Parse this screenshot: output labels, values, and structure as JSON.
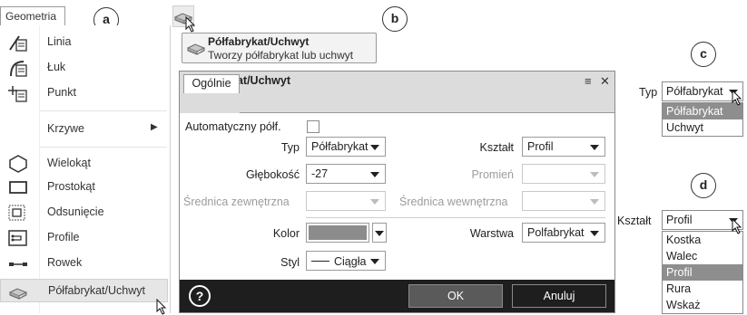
{
  "menu": {
    "tab_label": "Geometria",
    "callout": "a",
    "items": [
      {
        "label": "Linia",
        "icon": "line-icon"
      },
      {
        "label": "Łuk",
        "icon": "arc-icon"
      },
      {
        "label": "Punkt",
        "icon": "point-icon"
      },
      {
        "label": "Krzywe",
        "icon": "",
        "submenu_arrow": "▶"
      },
      {
        "label": "Wielokąt",
        "icon": "polygon-icon"
      },
      {
        "label": "Prostokąt",
        "icon": "rectangle-icon"
      },
      {
        "label": "Odsunięcie",
        "icon": "offset-icon"
      },
      {
        "label": "Profile",
        "icon": "profile-icon"
      },
      {
        "label": "Rowek",
        "icon": "groove-icon"
      },
      {
        "label": "Półfabrykat/Uchwyt",
        "icon": "stock-holder-icon",
        "selected": true
      }
    ]
  },
  "tooltip": {
    "callout": "b",
    "title": "Półfabrykat/Uchwyt",
    "description": "Tworzy półfabrykat lub uchwyt"
  },
  "dialog": {
    "title": "Półfabrykat/Uchwyt",
    "menu_glyph": "≡",
    "close_glyph": "✕",
    "tab": "Ogólnie",
    "auto_label": "Automatyczny półf.",
    "typ_label": "Typ",
    "typ_value": "Półfabrykat",
    "ksztalt_label": "Kształt",
    "ksztalt_value": "Profil",
    "glebokosc_label": "Głębokość",
    "glebokosc_value": "-27",
    "promien_label": "Promień",
    "srednica_zew_label": "Średnica zewnętrzna",
    "srednica_wew_label": "Średnica wewnętrzna",
    "kolor_label": "Kolor",
    "kolor_color": "#8c8c8c",
    "warstwa_label": "Warstwa",
    "warstwa_value": "Polfabrykat",
    "styl_label": "Styl",
    "styl_value": "Ciągła",
    "help_glyph": "?",
    "ok_label": "OK",
    "cancel_label": "Anuluj"
  },
  "dropdown_c": {
    "callout": "c",
    "label": "Typ",
    "value": "Półfabrykat",
    "options": [
      "Półfabrykat",
      "Uchwyt"
    ],
    "highlighted": 0
  },
  "dropdown_d": {
    "callout": "d",
    "label": "Kształt",
    "value": "Profil",
    "options": [
      "Kostka",
      "Walec",
      "Profil",
      "Rura",
      "Wskaż"
    ],
    "highlighted": 2
  }
}
